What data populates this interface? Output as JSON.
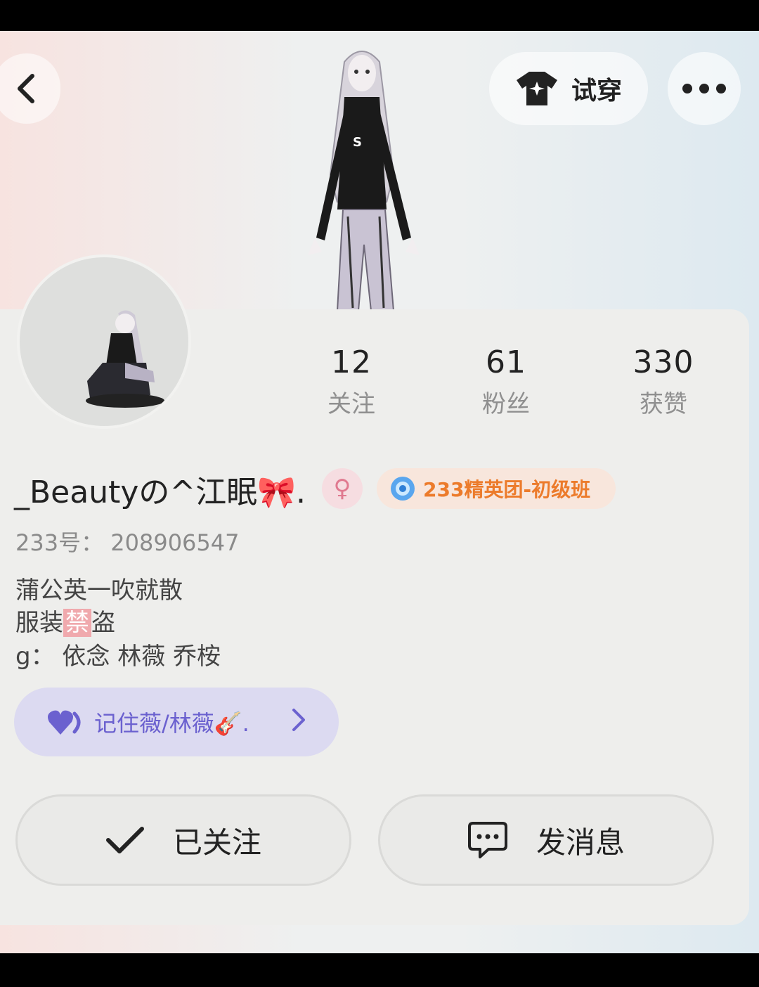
{
  "header": {
    "tryon_label": "试穿"
  },
  "stats": [
    {
      "value": "12",
      "label": "关注"
    },
    {
      "value": "61",
      "label": "粉丝"
    },
    {
      "value": "330",
      "label": "获赞"
    }
  ],
  "profile": {
    "username": "_Beautyの^江眠🎀.",
    "gender_symbol": "♀",
    "club_badge": "233精英团-初级班",
    "uid": "233号：  208906547",
    "bio_line1": "蒲公英一吹就散",
    "bio_line2_a": "服装",
    "bio_line2_ban": "禁",
    "bio_line2_b": "盗",
    "bio_line3": "g：  依念  林薇  乔桉"
  },
  "fan_group": {
    "label": "记住薇/林薇🎸."
  },
  "actions": {
    "follow_label": "已关注",
    "message_label": "发消息"
  },
  "colors": {
    "club_text": "#ec7b2b",
    "fan_text": "#6b61cf",
    "gender_badge": "#f6dde1"
  }
}
